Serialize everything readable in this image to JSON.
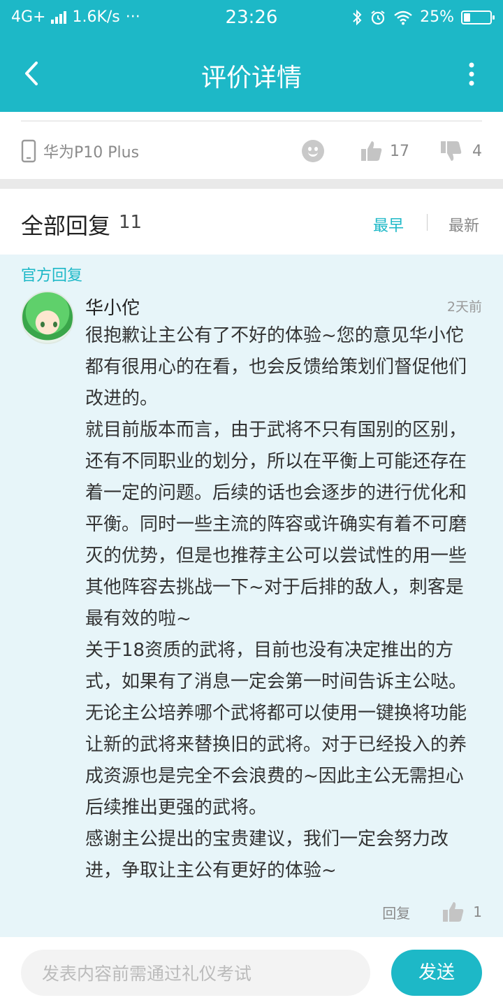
{
  "status_bar": {
    "network": "4G+",
    "speed": "1.6K/s",
    "dots": "···",
    "time": "23:26",
    "battery": "25%",
    "battery_level": 0.25
  },
  "nav": {
    "title": "评价详情",
    "back_icon": "back-chevron-icon",
    "more_icon": "more-vertical-icon"
  },
  "device": {
    "name": "华为P10 Plus",
    "likes": "17",
    "dislikes": "4"
  },
  "replies": {
    "title": "全部回复",
    "count": "11",
    "sort_earliest": "最早",
    "sort_latest": "最新"
  },
  "official_reply": {
    "label": "官方回复",
    "author": "华小佗",
    "time": "2天前",
    "paragraphs": [
      "很抱歉让主公有了不好的体验~您的意见华小佗都有很用心的在看，也会反馈给策划们督促他们改进的。",
      "就目前版本而言，由于武将不只有国别的区别，还有不同职业的划分，所以在平衡上可能还存在着一定的问题。后续的话也会逐步的进行优化和平衡。同时一些主流的阵容或许确实有着不可磨灭的优势，但是也推荐主公可以尝试性的用一些其他阵容去挑战一下~对于后排的敌人，刺客是最有效的啦~",
      "关于18资质的武将，目前也没有决定推出的方式，如果有了消息一定会第一时间告诉主公哒。无论主公培养哪个武将都可以使用一键换将功能让新的武将来替换旧的武将。对于已经投入的养成资源也是完全不会浪费的~因此主公无需担心后续推出更强的武将。",
      "感谢主公提出的宝贵建议，我们一定会努力改进，争取让主公有更好的体验~"
    ],
    "reply_label": "回复",
    "likes": "1"
  },
  "composer": {
    "placeholder": "发表内容前需通过礼仪考试",
    "send_label": "发送"
  },
  "colors": {
    "accent": "#1db8c7",
    "reply_bg": "#e7f5f9"
  }
}
